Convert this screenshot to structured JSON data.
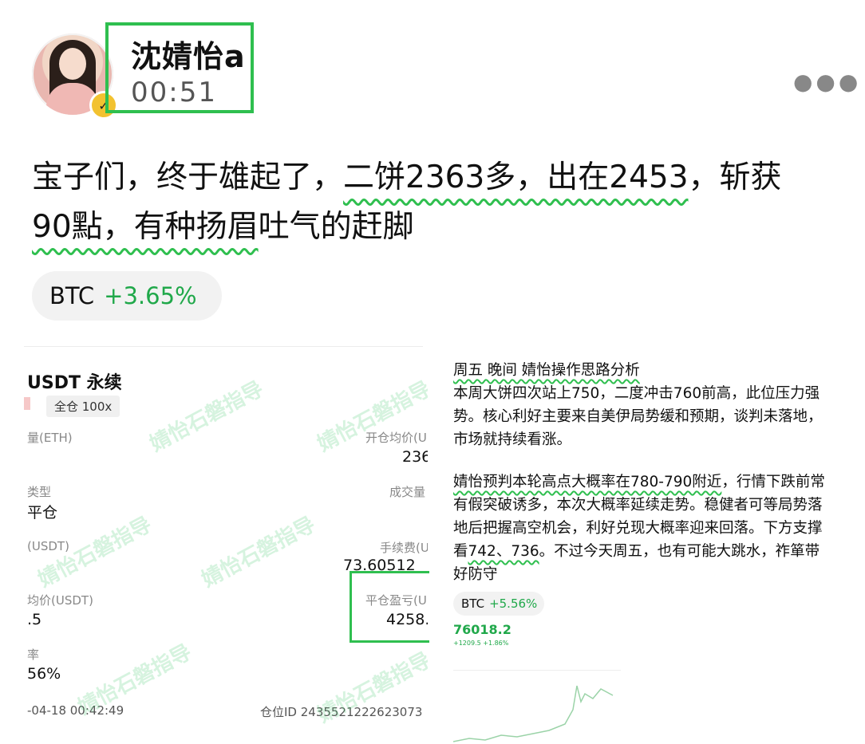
{
  "header": {
    "username": "沈婧怡a",
    "time": "00:51",
    "more_icon": "more-horizontal-icon",
    "badge_icon": "verified-check-icon"
  },
  "post": {
    "p1": "宝子们，终于雄起了，",
    "p2_highlight": "二饼2363多，出在2453",
    "p3": "，斩获",
    "p4_highlight": "90點，有种扬眉",
    "p5": "吐气的赶脚"
  },
  "tag": {
    "symbol": "BTC",
    "change": "+3.65%"
  },
  "left_image": {
    "title": "USDT 永续",
    "margin": "全仓 100x",
    "qty_label": "量(ETH)",
    "open_avg_label": "开仓均价(U",
    "open_avg_value": "236",
    "type_label": "类型",
    "type_value": "平仓",
    "volume_label": "成交量",
    "usdt_label": "(USDT)",
    "fee_label": "手续费(U",
    "fee_value": "73.60512",
    "avg_label": "均价(USDT)",
    "avg_value": ".5",
    "pnl_label": "平仓盈亏(U",
    "pnl_value": "4258.",
    "pct_label": "率",
    "pct_value": "56%",
    "datetime": "-04-18 00:42:49",
    "position_id": "仓位ID 2435521222623073",
    "watermark": "婧怡石磐指导"
  },
  "right_image": {
    "heading": "周五 晚间 婧怡操作思路分析",
    "para1": "本周大饼四次站上750，二度冲击760前高，此位压力强势。核心利好主要来自美伊局势缓和预期，谈判未落地，市场就持续看涨。",
    "para2_a": "婧怡预判本轮高点大概率在780-790附近",
    "para2_b": "，行情下跌前常有假突破诱多，本次大概率延续走势。稳健者可等局势落地后把握高空机会，利好兑现大概率迎来回落。下方支撑看",
    "para2_c": "742、736",
    "para2_d": "。不过今天周五，也有可能大跳水，祚箪带好防守",
    "chip_symbol": "BTC",
    "chip_change": "+5.56%",
    "mini_price": "76018.2",
    "mini_change": "+1209.5  +1.86%"
  }
}
